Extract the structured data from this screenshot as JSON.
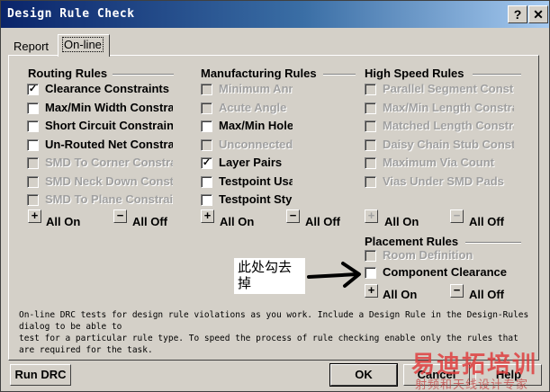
{
  "window": {
    "title": "Design Rule Check",
    "help_glyph": "?",
    "close_glyph": "✕"
  },
  "tabs": [
    {
      "label": "Report"
    },
    {
      "label": "On-line"
    }
  ],
  "routing": {
    "title": "Routing Rules",
    "items": [
      {
        "label": "Clearance Constraints",
        "checked": true,
        "enabled": true
      },
      {
        "label": "Max/Min Width Constraint",
        "checked": false,
        "enabled": true
      },
      {
        "label": "Short Circuit Constraint",
        "checked": false,
        "enabled": true
      },
      {
        "label": "Un-Routed Net Constraint",
        "checked": false,
        "enabled": true
      },
      {
        "label": "SMD To Corner Constraint",
        "checked": false,
        "enabled": false
      },
      {
        "label": "SMD Neck Down Constraint",
        "checked": false,
        "enabled": false
      },
      {
        "label": "SMD To Plane Constraint",
        "checked": false,
        "enabled": false
      }
    ],
    "all_on": "All On",
    "all_off": "All Off"
  },
  "manufacturing": {
    "title": "Manufacturing Rules",
    "items": [
      {
        "label": "Minimum Annular",
        "checked": false,
        "enabled": false
      },
      {
        "label": "Acute Angle",
        "checked": false,
        "enabled": false
      },
      {
        "label": "Max/Min Hole Size",
        "checked": false,
        "enabled": true
      },
      {
        "label": "Unconnected Pins",
        "checked": false,
        "enabled": false
      },
      {
        "label": "Layer Pairs",
        "checked": true,
        "enabled": true
      },
      {
        "label": "Testpoint Usage",
        "checked": false,
        "enabled": true
      },
      {
        "label": "Testpoint Style",
        "checked": false,
        "enabled": true
      }
    ],
    "all_on": "All On",
    "all_off": "All Off"
  },
  "highspeed": {
    "title": "High Speed Rules",
    "items": [
      {
        "label": "Parallel Segment Constraint",
        "checked": false,
        "enabled": false
      },
      {
        "label": "Max/Min Length Constraint",
        "checked": false,
        "enabled": false
      },
      {
        "label": "Matched Length Constraint",
        "checked": false,
        "enabled": false
      },
      {
        "label": "Daisy Chain Stub Constraint",
        "checked": false,
        "enabled": false
      },
      {
        "label": "Maximum Via Count",
        "checked": false,
        "enabled": false
      },
      {
        "label": "Vias Under SMD Pads",
        "checked": false,
        "enabled": false
      }
    ],
    "all_on": "All On",
    "all_off": "All Off"
  },
  "placement": {
    "title": "Placement Rules",
    "items": [
      {
        "label": "Room Definition",
        "checked": false,
        "enabled": false
      },
      {
        "label": "Component Clearance",
        "checked": false,
        "enabled": true
      }
    ],
    "all_on": "All On",
    "all_off": "All Off"
  },
  "annotation": {
    "text": "此处勾去掉"
  },
  "description": "On-line DRC tests for design rule violations as you work. Include a Design Rule in the Design-Rules dialog to be able to\ntest for a particular rule type. To speed the process of rule checking enable only the rules that are required for the task.",
  "buttons": {
    "run_drc": "Run DRC",
    "ok": "OK",
    "cancel": "Cancel",
    "help": "Help"
  },
  "watermark": {
    "main": "易迪拓培训",
    "sub": "射频和天线设计专家"
  },
  "colors": {
    "title_start": "#0a246a",
    "title_end": "#a6caf0",
    "face": "#d4d0c8",
    "disabled_text": "#a0a0a0",
    "watermark": "#e03a3a"
  }
}
